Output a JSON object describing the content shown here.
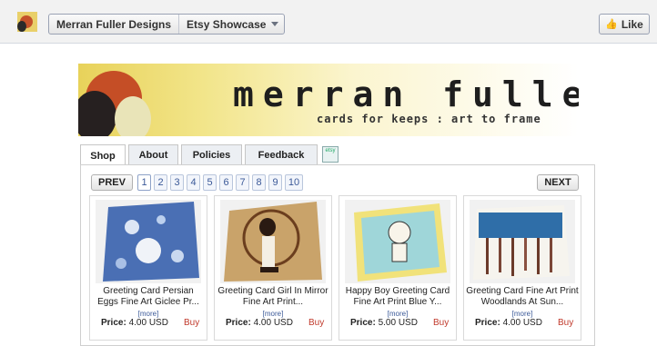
{
  "header": {
    "page_name": "Merran Fuller Designs",
    "app_name": "Etsy Showcase",
    "like_label": "Like"
  },
  "banner": {
    "title": "merran fuller",
    "tagline": "cards for keeps : art to frame"
  },
  "tabs": [
    {
      "label": "Shop",
      "active": true
    },
    {
      "label": "About"
    },
    {
      "label": "Policies"
    },
    {
      "label": "Feedback"
    }
  ],
  "tab_icon": {
    "name": "etsy-icon",
    "text": "etsy"
  },
  "pagination": {
    "prev_label": "PREV",
    "next_label": "NEXT",
    "pages": [
      "1",
      "2",
      "3",
      "4",
      "5",
      "6",
      "7",
      "8",
      "9",
      "10"
    ],
    "current": "1"
  },
  "products": [
    {
      "title": "Greeting Card Persian Eggs Fine Art Giclee Pr...",
      "more": "[more]",
      "price_label": "Price:",
      "price": "4.00 USD",
      "buy": "Buy"
    },
    {
      "title": "Greeting Card Girl In Mirror Fine Art Print...",
      "more": "[more]",
      "price_label": "Price:",
      "price": "4.00 USD",
      "buy": "Buy"
    },
    {
      "title": "Happy Boy Greeting Card Fine Art Print Blue Y...",
      "more": "[more]",
      "price_label": "Price:",
      "price": "5.00 USD",
      "buy": "Buy"
    },
    {
      "title": "Greeting Card Fine Art Print Woodlands At Sun...",
      "more": "[more]",
      "price_label": "Price:",
      "price": "4.00 USD",
      "buy": "Buy"
    }
  ],
  "colors": {
    "link": "#3b5998",
    "buy": "#c0392b",
    "banner_yellow": "#e8d25a"
  }
}
